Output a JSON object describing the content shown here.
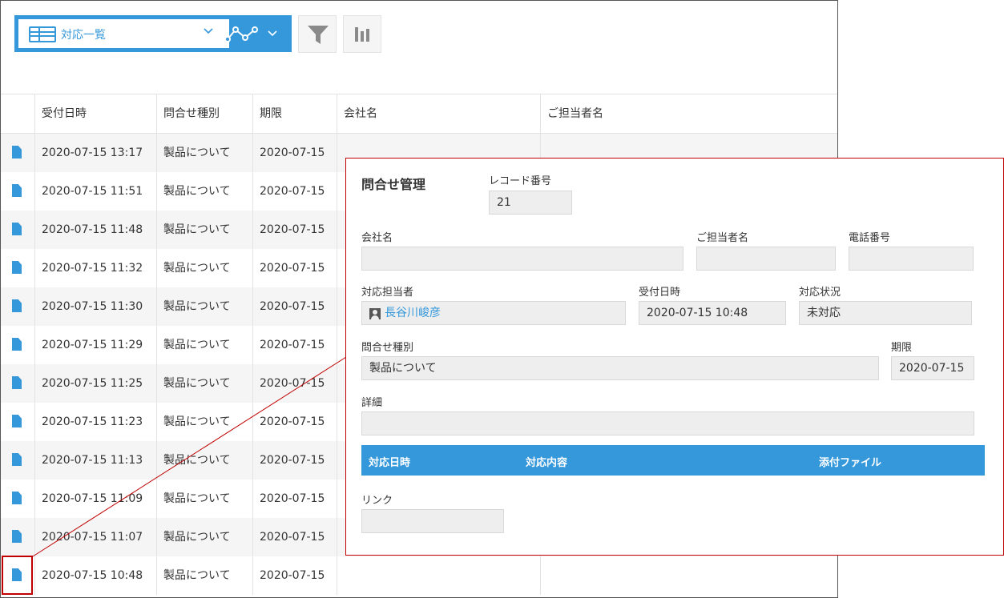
{
  "view": {
    "name": "対応一覧"
  },
  "columns": [
    "",
    "受付日時",
    "問合せ種別",
    "期限",
    "会社名",
    "ご担当者名"
  ],
  "rows": [
    {
      "received": "2020-07-15 13:17",
      "type": "製品について",
      "deadline": "2020-07-15"
    },
    {
      "received": "2020-07-15 11:51",
      "type": "製品について",
      "deadline": "2020-07-15"
    },
    {
      "received": "2020-07-15 11:48",
      "type": "製品について",
      "deadline": "2020-07-15"
    },
    {
      "received": "2020-07-15 11:32",
      "type": "製品について",
      "deadline": "2020-07-15"
    },
    {
      "received": "2020-07-15 11:30",
      "type": "製品について",
      "deadline": "2020-07-15"
    },
    {
      "received": "2020-07-15 11:29",
      "type": "製品について",
      "deadline": "2020-07-15"
    },
    {
      "received": "2020-07-15 11:25",
      "type": "製品について",
      "deadline": "2020-07-15"
    },
    {
      "received": "2020-07-15 11:23",
      "type": "製品について",
      "deadline": "2020-07-15"
    },
    {
      "received": "2020-07-15 11:13",
      "type": "製品について",
      "deadline": "2020-07-15"
    },
    {
      "received": "2020-07-15 11:09",
      "type": "製品について",
      "deadline": "2020-07-15"
    },
    {
      "received": "2020-07-15 11:07",
      "type": "製品について",
      "deadline": "2020-07-15"
    },
    {
      "received": "2020-07-15 10:48",
      "type": "製品について",
      "deadline": "2020-07-15"
    }
  ],
  "detail": {
    "title": "問合せ管理",
    "record_no_label": "レコード番号",
    "record_no": "21",
    "company_label": "会社名",
    "company": "",
    "contact_label": "ご担当者名",
    "contact": "",
    "phone_label": "電話番号",
    "phone": "",
    "assignee_label": "対応担当者",
    "assignee": "長谷川峻彦",
    "received_label": "受付日時",
    "received": "2020-07-15 10:48",
    "status_label": "対応状況",
    "status": "未対応",
    "type_label": "問合せ種別",
    "type": "製品について",
    "deadline_label": "期限",
    "deadline": "2020-07-15",
    "details_label": "詳細",
    "details": "",
    "subtable_headers": [
      "対応日時",
      "対応内容",
      "添付ファイル"
    ],
    "link_label": "リンク",
    "link": ""
  },
  "colors": {
    "accent": "#3498db",
    "highlight": "#c00000",
    "field_bg": "#eeeeee",
    "row_alt": "#f5f5f5"
  },
  "icons": [
    "table-icon",
    "chevron-down-icon",
    "graph-icon",
    "filter-icon",
    "bar-chart-icon",
    "record-detail-icon",
    "user-icon"
  ]
}
